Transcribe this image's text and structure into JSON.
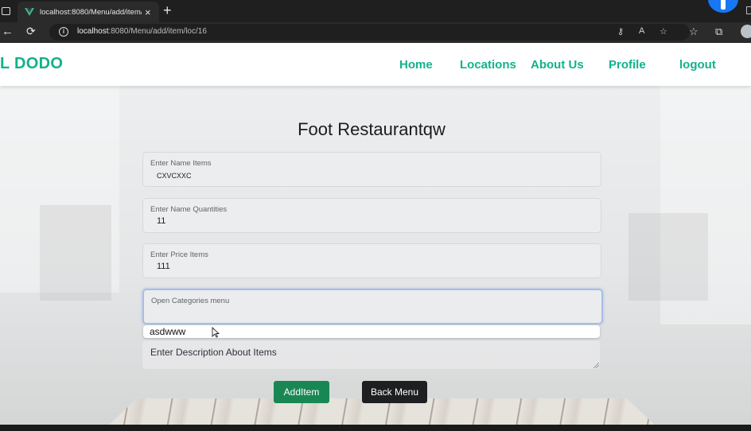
{
  "browser": {
    "tab_title": "localhost:8080/Menu/add/item/l",
    "tab_close": "×",
    "new_tab": "+",
    "url_host": "localhost",
    "url_rest": ":8080/Menu/add/item/loc/16",
    "back_glyph": "←",
    "reload_glyph": "C"
  },
  "nav": {
    "brand": "L DODO",
    "links": [
      "Home",
      "Locations",
      "About Us",
      "Profile",
      "logout"
    ]
  },
  "page": {
    "title": "Foot Restaurantqw",
    "fields": [
      {
        "label": "Enter Name Items",
        "value": "CXVCXXC"
      },
      {
        "label": "Enter Name Quantities",
        "value": "11"
      },
      {
        "label": "Enter Price Items",
        "value": "111"
      },
      {
        "label": "Open Categories menu",
        "value": ""
      }
    ],
    "dropdown_option": "asdwww",
    "description_placeholder": "Enter Description About Items",
    "add_button": "AddItem",
    "back_button": "Back Menu"
  },
  "colors": {
    "brand": "#11b28b",
    "add_button": "#198754",
    "back_button": "#1d1f21"
  },
  "icons": [
    "window-icon",
    "vue-logo-icon",
    "close-icon",
    "plus-icon",
    "back-arrow-icon",
    "reload-icon",
    "info-icon",
    "key-icon",
    "read-aloud-icon",
    "favorite-add-icon",
    "favorites-icon",
    "collections-icon",
    "profile-avatar-icon"
  ]
}
